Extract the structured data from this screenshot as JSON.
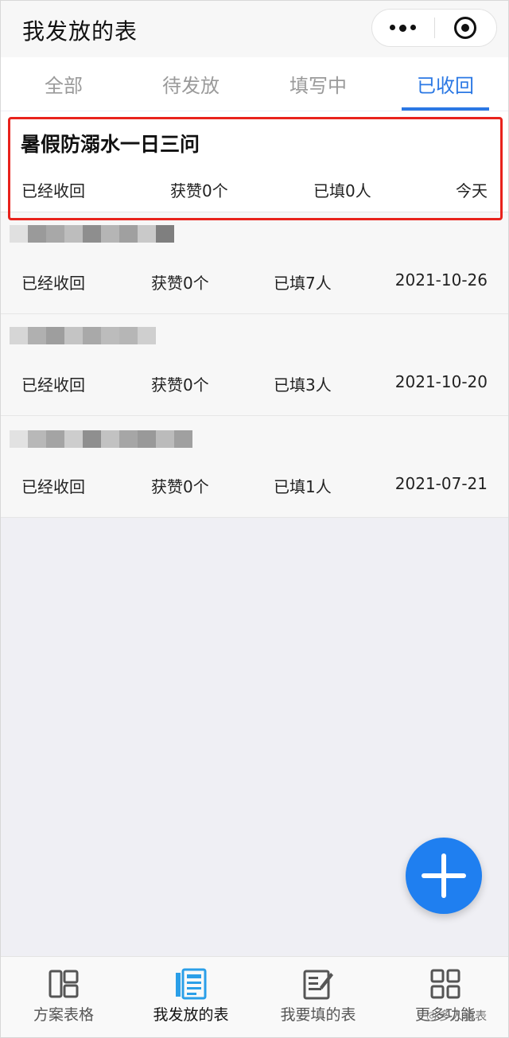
{
  "header": {
    "title": "我发放的表"
  },
  "tabs": [
    "全部",
    "待发放",
    "填写中",
    "已收回"
  ],
  "active_tab_index": 3,
  "items": [
    {
      "title": "暑假防溺水一日三问",
      "status": "已经收回",
      "likes": "获赞0个",
      "filled": "已填0人",
      "date": "今天",
      "highlighted": true
    },
    {
      "title": "",
      "status": "已经收回",
      "likes": "获赞0个",
      "filled": "已填7人",
      "date": "2021-10-26"
    },
    {
      "title": "",
      "status": "已经收回",
      "likes": "获赞0个",
      "filled": "已填3人",
      "date": "2021-10-20"
    },
    {
      "title": "",
      "status": "已经收回",
      "likes": "获赞0个",
      "filled": "已填1人",
      "date": "2021-07-21"
    }
  ],
  "bottom_nav": [
    {
      "label": "方案表格",
      "icon": "layout-icon"
    },
    {
      "label": "我发放的表",
      "icon": "document-list-icon"
    },
    {
      "label": "我要填的表",
      "icon": "edit-form-icon"
    },
    {
      "label": "更多功能",
      "icon": "grid-icon"
    }
  ],
  "active_nav_index": 1,
  "watermark": "多人填表",
  "colors": {
    "accent": "#2b78e4",
    "fab": "#1f7ff0",
    "highlight": "#e8221c"
  }
}
